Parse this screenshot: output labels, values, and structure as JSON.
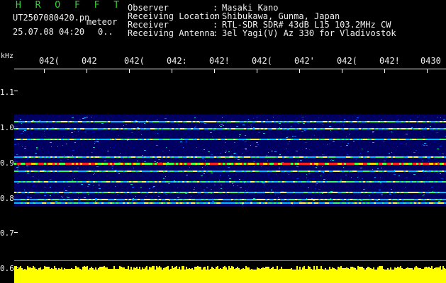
{
  "header": {
    "title": "H R O F F T",
    "filename": "UT2507080420.pn",
    "meteor_label": "meteor",
    "datetime": "25.07.08 04:20",
    "count": "0..",
    "fields": [
      {
        "label": "Observer",
        "sep": ":",
        "value": "Masaki Kano"
      },
      {
        "label": "Receiving Location",
        "sep": ":",
        "value": "Shibukawa, Gunma, Japan"
      },
      {
        "label": "Receiver",
        "sep": ":",
        "value": "RTL-SDR SDR# 43dB L15 103.2MHz CW"
      },
      {
        "label": "Receiving Antenna",
        "sep": ":",
        "value": "3el Yagi(V) Az 330 for Vladivostok"
      }
    ]
  },
  "axis": {
    "unit": "kHz",
    "x_ticks": [
      "042(",
      "042",
      "042(",
      "042:",
      "042!",
      "042(",
      "042'",
      "042(",
      "042!",
      "0430"
    ],
    "y_ticks": [
      "1.1",
      "1.0",
      "0.9",
      "0.8",
      "0.7",
      "0.6"
    ]
  },
  "colors": {
    "text_green": "#36d236",
    "text_white": "#f0f0f0",
    "text_yellow": "#ffff22",
    "background": "#000000",
    "spectrum_base": "#00006e",
    "signal_strong": "#ff2020",
    "power_trace": "#ffff00"
  },
  "spectrogram": {
    "lines_khz": [
      1.02,
      1.0,
      0.97,
      0.92,
      0.9,
      0.88,
      0.85,
      0.82,
      0.8,
      0.79
    ],
    "strong_line_khz": 0.9
  }
}
